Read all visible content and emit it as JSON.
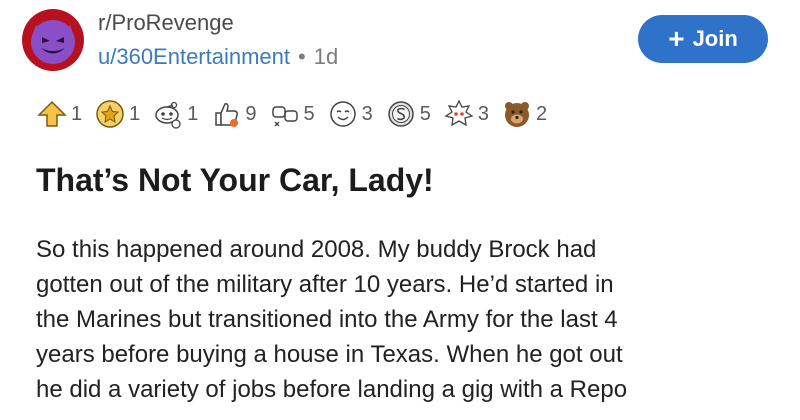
{
  "header": {
    "subreddit": "r/ProRevenge",
    "username": "u/360Entertainment",
    "separator": "•",
    "age": "1d",
    "join_label": "Join",
    "join_icon": "+"
  },
  "awards": [
    {
      "icon": "upvote-award-icon",
      "count": "1"
    },
    {
      "icon": "gold-medal-icon",
      "count": "1"
    },
    {
      "icon": "snoo-award-icon",
      "count": "1"
    },
    {
      "icon": "thumbs-up-award-icon",
      "count": "9"
    },
    {
      "icon": "fist-bump-icon",
      "count": "5"
    },
    {
      "icon": "wholesome-face-icon",
      "count": "3"
    },
    {
      "icon": "silver-coin-icon",
      "count": "5"
    },
    {
      "icon": "helpful-snoo-icon",
      "count": "3"
    },
    {
      "icon": "bear-award-icon",
      "count": "2"
    }
  ],
  "post": {
    "title": "That’s Not Your Car, Lady!",
    "body_lines": [
      "So this happened around 2008. My buddy Brock had",
      "gotten out of the military after 10 years. He’d started in",
      "the Marines but transitioned into the Army for the last 4",
      "years before buying a house in Texas. When he got out",
      "he did a variety of jobs before landing a gig with a Repo"
    ]
  },
  "colors": {
    "join_button": "#2f72c9",
    "username": "#3a7bbf",
    "avatar_bg": "#b7111f",
    "avatar_face": "#8a4fc6"
  }
}
